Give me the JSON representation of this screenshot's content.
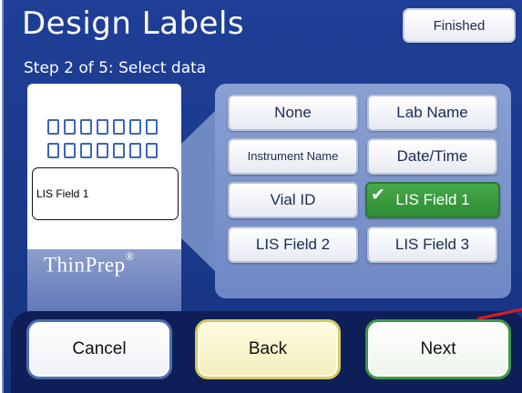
{
  "header": {
    "title": "Design Labels",
    "finished_label": "Finished"
  },
  "step_text": "Step 2 of 5: Select data",
  "label_preview": {
    "field_text": "LIS Field 1",
    "brand": "ThinPrep",
    "brand_mark": "®",
    "barcode_cells": 14
  },
  "options": {
    "none": "None",
    "lab_name": "Lab Name",
    "instrument_name": "Instrument Name",
    "date_time": "Date/Time",
    "vial_id": "Vial ID",
    "lis_field_1": "LIS Field 1",
    "lis_field_2": "LIS Field 2",
    "lis_field_3": "LIS Field 3",
    "selected": "lis_field_1",
    "check_glyph": "✔"
  },
  "actions": {
    "cancel_label": "Cancel",
    "back_label": "Back",
    "next_label": "Next"
  },
  "colors": {
    "background": "#1b3a8e",
    "selected": "#3a9a3e",
    "pointer": "#e01b1b"
  }
}
